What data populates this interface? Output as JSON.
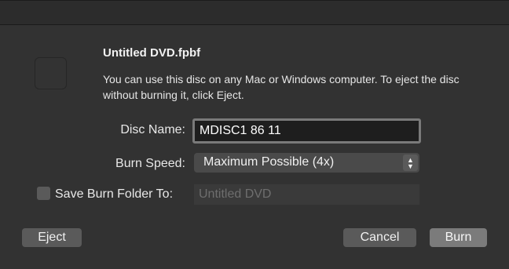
{
  "dialog": {
    "title": "Untitled DVD.fpbf",
    "message": "You can use this disc on any Mac or Windows computer. To eject the disc without burning it, click Eject.",
    "icon": "disc-icon"
  },
  "form": {
    "disc_name_label": "Disc Name:",
    "disc_name_value": "MDISC1 86 11",
    "burn_speed_label": "Burn Speed:",
    "burn_speed_selected": "Maximum Possible (4x)",
    "save_folder_label": "Save Burn Folder To:",
    "save_folder_checked": false,
    "save_folder_placeholder": "Untitled DVD"
  },
  "buttons": {
    "eject": "Eject",
    "cancel": "Cancel",
    "burn": "Burn"
  },
  "colors": {
    "background": "#323232",
    "field_border": "#7a7a7a",
    "default_button": "#7b7b7b"
  }
}
